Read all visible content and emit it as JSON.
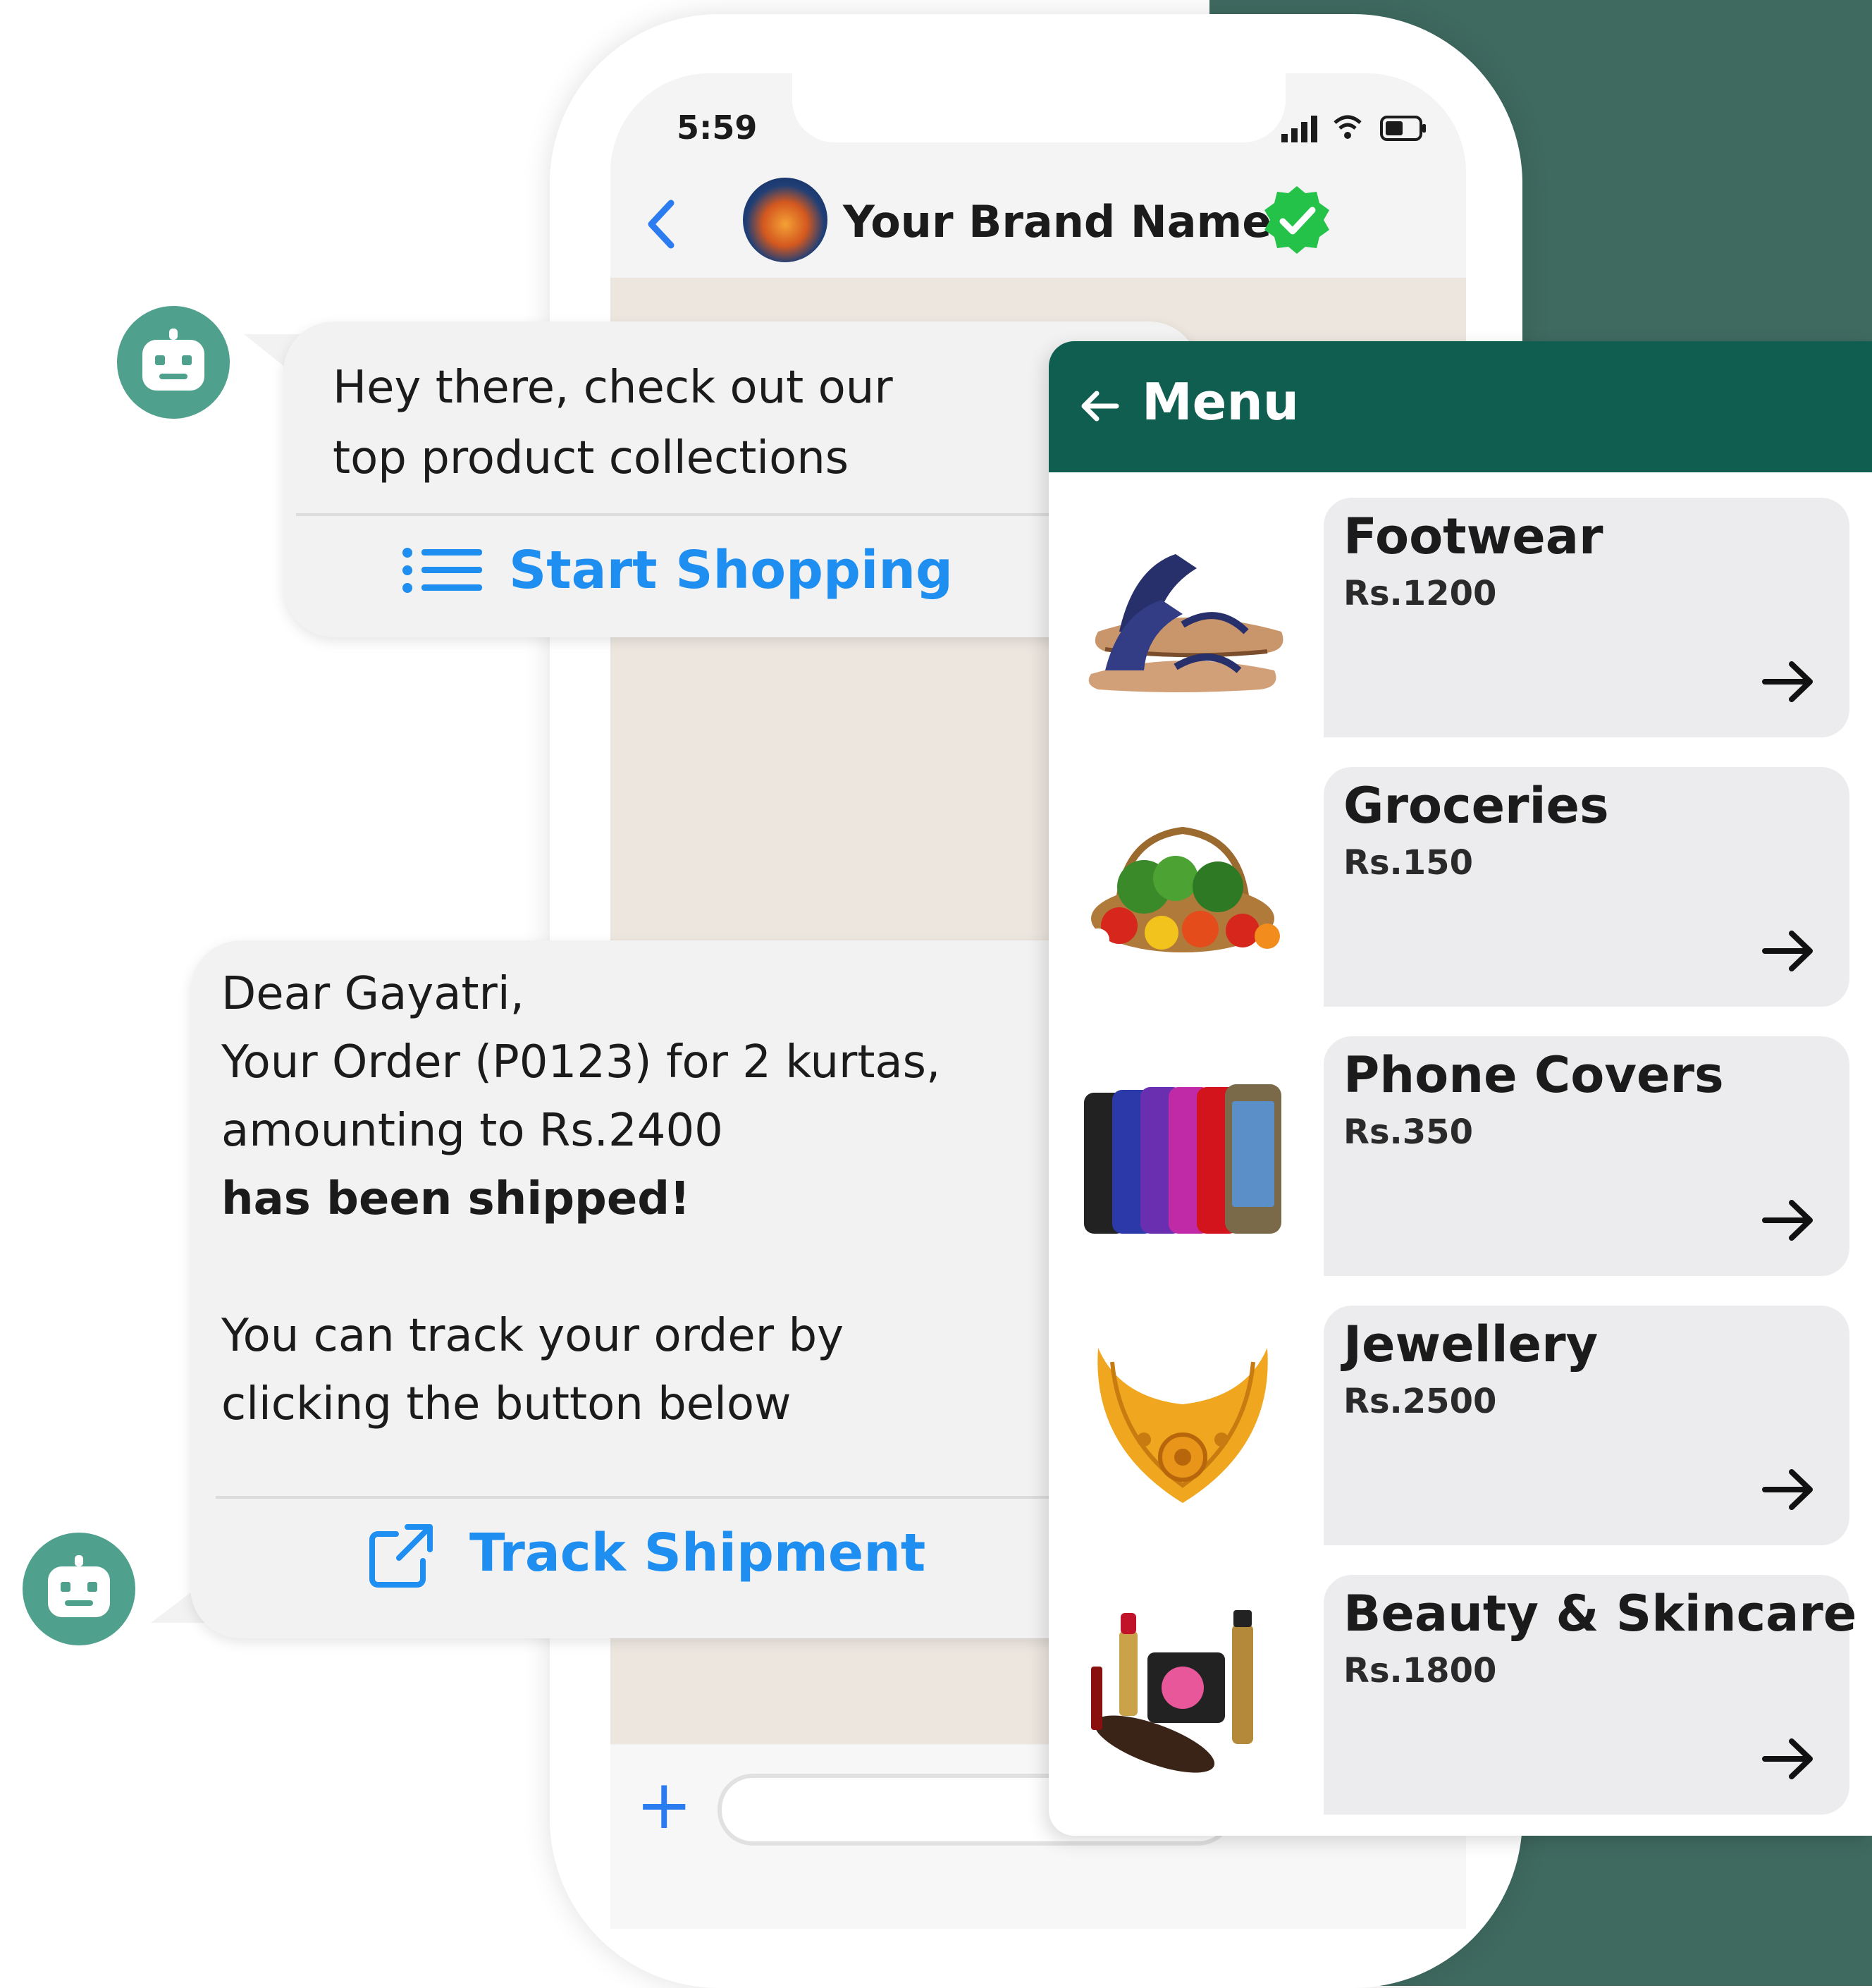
{
  "status_bar": {
    "time": "5:59"
  },
  "chat_header": {
    "brand_name": "Your Brand Name"
  },
  "message_1": {
    "line1": "Hey there, check out our",
    "line2": "top product collections",
    "button_label": "Start Shopping"
  },
  "message_2": {
    "line1": "Dear Gayatri,",
    "line2": "Your Order (P0123) for 2 kurtas,",
    "line3": "amounting to Rs.2400",
    "line4_bold": "has been shipped!",
    "line5": "You can track your order by",
    "line6": "clicking the button below",
    "button_label": "Track Shipment"
  },
  "menu": {
    "title": "Menu",
    "items": [
      {
        "name": "Footwear",
        "price": "Rs.1200",
        "icon": "sandal-icon"
      },
      {
        "name": "Groceries",
        "price": "Rs.150",
        "icon": "vegetables-icon"
      },
      {
        "name": "Phone Covers",
        "price": "Rs.350",
        "icon": "phone-cover-icon"
      },
      {
        "name": "Jewellery",
        "price": "Rs.2500",
        "icon": "necklace-icon"
      },
      {
        "name": "Beauty & Skincare",
        "price": "Rs.1800",
        "icon": "cosmetics-icon"
      }
    ]
  },
  "colors": {
    "accent_blue": "#1f8ef1",
    "menu_header_green": "#0f5e4f",
    "bot_green": "#4fa08d",
    "background_green": "#3f6a60",
    "verified_green": "#25c24a"
  }
}
